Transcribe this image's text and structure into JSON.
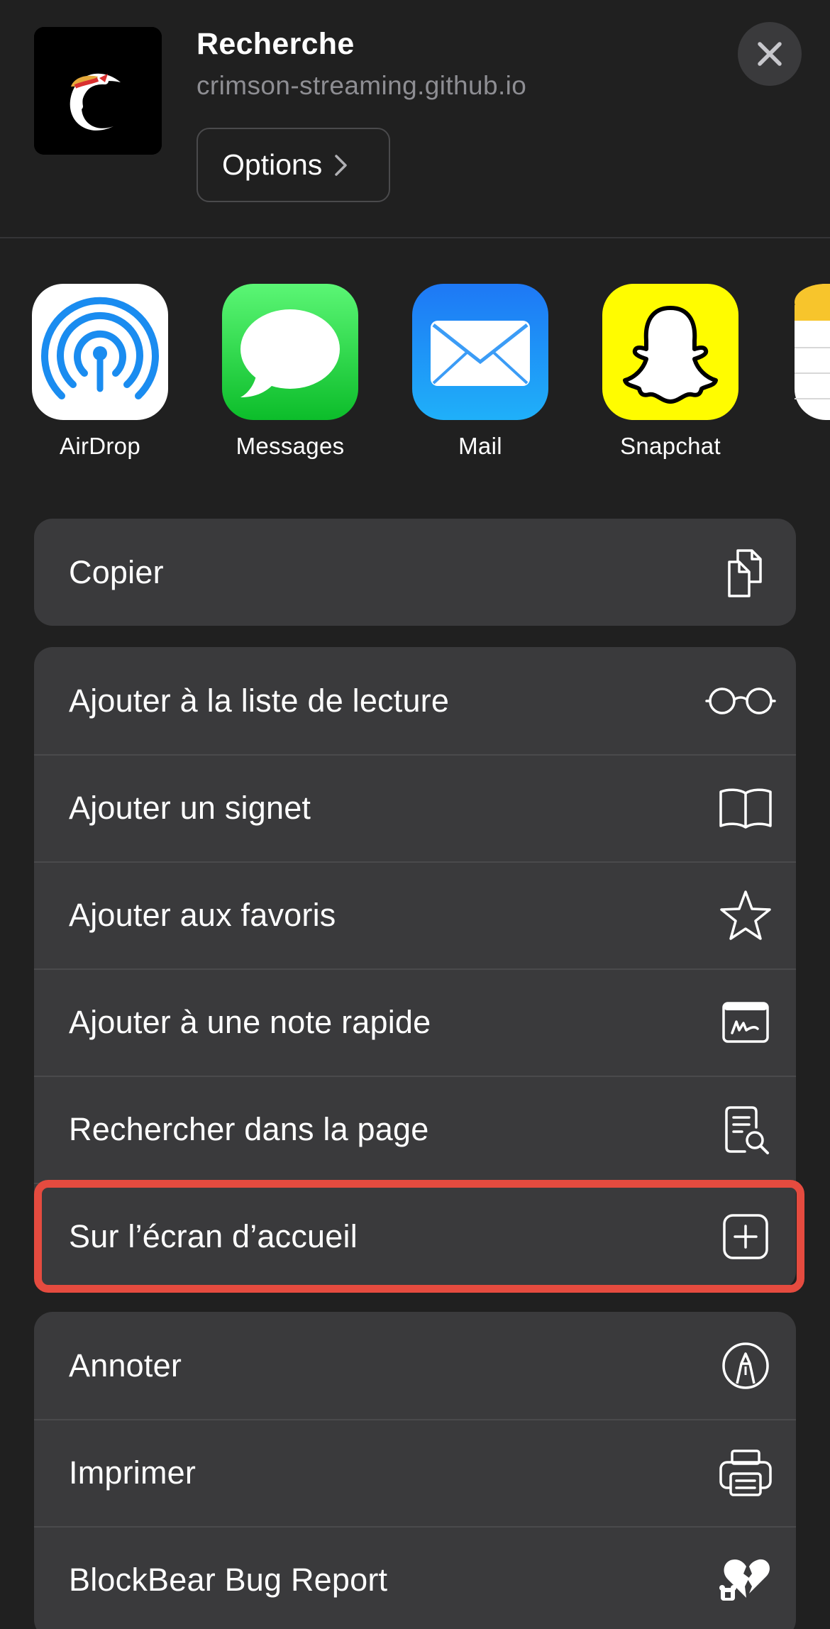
{
  "header": {
    "title": "Recherche",
    "url": "crimson-streaming.github.io",
    "options_label": "Options",
    "app_icon": "crimson-logo-icon",
    "close_icon": "close-icon"
  },
  "share_apps": [
    {
      "label": "AirDrop",
      "icon": "airdrop-icon"
    },
    {
      "label": "Messages",
      "icon": "messages-icon"
    },
    {
      "label": "Mail",
      "icon": "mail-icon"
    },
    {
      "label": "Snapchat",
      "icon": "snapchat-icon"
    },
    {
      "label": "",
      "icon": "notes-icon"
    }
  ],
  "actions": {
    "group1": [
      {
        "label": "Copier",
        "icon": "copy-icon"
      }
    ],
    "group2": [
      {
        "label": "Ajouter à la liste de lecture",
        "icon": "glasses-icon"
      },
      {
        "label": "Ajouter un signet",
        "icon": "book-icon"
      },
      {
        "label": "Ajouter aux favoris",
        "icon": "star-icon"
      },
      {
        "label": "Ajouter à une note rapide",
        "icon": "quick-note-icon"
      },
      {
        "label": "Rechercher dans la page",
        "icon": "find-in-page-icon"
      },
      {
        "label": "Sur l’écran d’accueil",
        "icon": "add-square-icon",
        "highlighted": true
      }
    ],
    "group3": [
      {
        "label": "Annoter",
        "icon": "markup-icon"
      },
      {
        "label": "Imprimer",
        "icon": "printer-icon"
      },
      {
        "label": "BlockBear Bug Report",
        "icon": "broken-heart-bear-icon"
      }
    ]
  },
  "colors": {
    "background": "#202020",
    "cell": "#3a3a3c",
    "highlight": "#e54b3f",
    "secondary_text": "#8e8e93"
  }
}
